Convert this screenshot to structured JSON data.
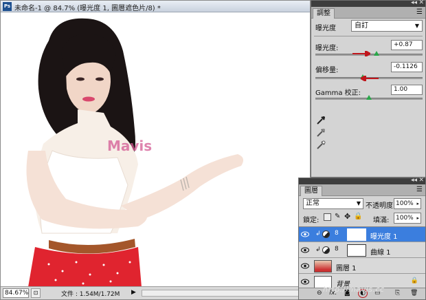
{
  "document": {
    "app_icon_label": "Ps",
    "title": "未命名-1 @ 84.7% (曝光度 1, 圖層遮色片/8) *",
    "canvas_watermark": "Mavis",
    "status": {
      "zoom": "84.67%",
      "file_info": "文件 : 1.54M/1.72M",
      "arrow": "▶"
    }
  },
  "adjustments_panel": {
    "tab_label": "調整",
    "preset_label": "曝光度",
    "preset_value": "自訂",
    "controls": [
      {
        "label": "曝光度:",
        "value": "+0.87",
        "slider_fraction": 0.57
      },
      {
        "label": "偏移量:",
        "value": "-0.1126",
        "slider_fraction": 0.44
      },
      {
        "label": "Gamma 校正:",
        "value": "1.00",
        "slider_fraction": 0.5
      }
    ],
    "eyedroppers": [
      "black-point-eyedropper",
      "gray-point-eyedropper",
      "white-point-eyedropper"
    ],
    "accent_colors": {
      "slider_thumb": "#2aa84a",
      "annotation_arrow": "#c0161c"
    }
  },
  "layers_panel": {
    "tab_label": "圖層",
    "blend_mode": "正常",
    "opacity_label": "不透明度:",
    "opacity_value": "100%",
    "lock_label": "鎖定:",
    "fill_label": "填滿:",
    "fill_value": "100%",
    "layers": [
      {
        "name": "曝光度 1",
        "selected": true
      },
      {
        "name": "曲線 1",
        "selected": false
      },
      {
        "name": "圖層 1",
        "selected": false
      },
      {
        "name": "背景",
        "selected": false
      }
    ],
    "footer_icons": [
      "link-icon",
      "fx-icon",
      "mask-icon",
      "new-adjustment-icon",
      "group-icon",
      "new-layer-icon",
      "trash-icon"
    ],
    "footer_fx_label": "fx.",
    "selected_color": "#3b7ede"
  },
  "watermark": "http://mavis.cc"
}
